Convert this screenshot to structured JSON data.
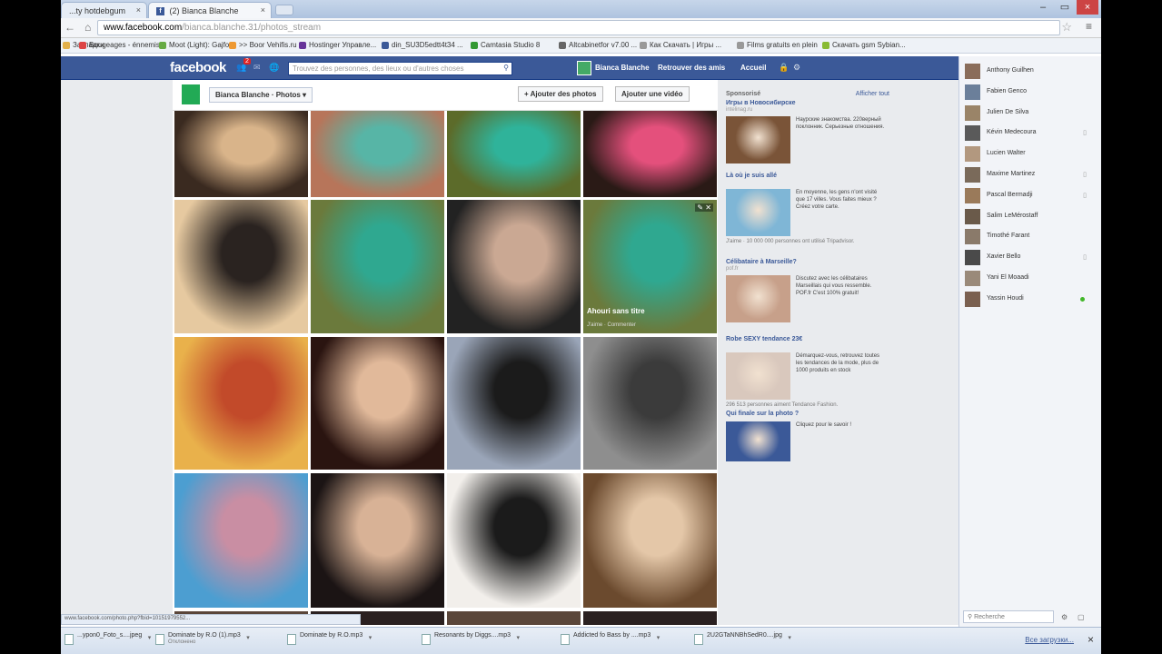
{
  "browser": {
    "tabs": [
      {
        "label": "...ty hotdebgum",
        "active": false
      },
      {
        "label": "(2) Bianca Blanche",
        "active": true
      }
    ],
    "url_domain": "www.facebook.com",
    "url_rest": "/bianca.blanche.31/photos_stream",
    "bookmarks": [
      {
        "label": "Закладки",
        "color": "#e2b04a"
      },
      {
        "label": "Bougeages - énnemis...",
        "color": "#d44"
      },
      {
        "label": "Moot (Light): Gajfor",
        "color": "#6a4"
      },
      {
        "label": ">> Boor Vehifis.ru ...",
        "color": "#e93"
      },
      {
        "label": "Hostinger Управле...",
        "color": "#639"
      },
      {
        "label": "din_SU3D5edtt4t34 ...",
        "color": "#3b5998"
      },
      {
        "label": "Camtasia Studio 8",
        "color": "#393"
      },
      {
        "label": "Altcabinetfor v7.00 ...",
        "color": "#666"
      },
      {
        "label": "Как Скачать | Игры ...",
        "color": "#999"
      },
      {
        "label": "Films gratuits en plein",
        "color": "#999"
      },
      {
        "label": "Скачать gsm Sybian...",
        "color": "#8b3"
      }
    ]
  },
  "fb": {
    "logo": "facebook",
    "notif_count": "2",
    "search_placeholder": "Trouvez des personnes, des lieux ou d'autres choses",
    "profile_name": "Bianca Blanche",
    "find_friends": "Retrouver des amis",
    "home": "Accueil"
  },
  "album": {
    "name": "Bianca Blanche",
    "section": "Photos",
    "add_photos": "+ Ajouter des photos",
    "add_video": "Ajouter une vidéo",
    "hover_caption": "Ahouri sans titre",
    "hover_actions": "J'aime · Commenter"
  },
  "photos": [
    {
      "c1": "#3a2a20",
      "c2": "#d9b48a"
    },
    {
      "c1": "#b7755a",
      "c2": "#57b5a6"
    },
    {
      "c1": "#5c6b2a",
      "c2": "#2fb39a"
    },
    {
      "c1": "#2a1a16",
      "c2": "#e4507c"
    },
    {
      "c1": "#e6c9a0",
      "c2": "#2a2320"
    },
    {
      "c1": "#6b7a3c",
      "c2": "#2fa890"
    },
    {
      "c1": "#222",
      "c2": "#caa893"
    },
    {
      "c1": "#6b7a3c",
      "c2": "#2fa890"
    },
    {
      "c1": "#e9b14b",
      "c2": "#c24a2a"
    },
    {
      "c1": "#2a1410",
      "c2": "#e1b99a"
    },
    {
      "c1": "#9aa5b8",
      "c2": "#1b1b1b"
    },
    {
      "c1": "#8e8e8e",
      "c2": "#3b3b3b"
    },
    {
      "c1": "#4c9ed1",
      "c2": "#c98ea3"
    },
    {
      "c1": "#1b1414",
      "c2": "#d8b296"
    },
    {
      "c1": "#f2efeb",
      "c2": "#1b1b1b"
    },
    {
      "c1": "#6b4a2e",
      "c2": "#e4c7a8"
    }
  ],
  "ads": {
    "heading": "Sponsorisé",
    "see_all": "Afficher tout",
    "items": [
      {
        "title": "Игры в Новосибирске",
        "sub": "intelinag.ru",
        "text": "Наурские знакомства. 220верный поклонник. Серьезные отношения.",
        "color": "#7a5438"
      },
      {
        "title": "Là où je suis allé",
        "sub": "",
        "text": "En moyenne, les gens n'ont visité que 17 villes. Vous faites mieux ? Créez votre carte.",
        "color": "#7fb6d6",
        "foot": "J'aime · 10 000 000 personnes ont utilisé Tripadvisor."
      },
      {
        "title": "Célibataire à Marseille?",
        "sub": "pof.fr",
        "text": "Discutez avec les célibataires Marseillais qui vous ressemble. POF.fr C'est 100% gratuit!",
        "color": "#c7a08a"
      },
      {
        "title": "Robe SEXY tendance 23€",
        "sub": "",
        "text": "Démarquez-vous, retrouvez toutes les tendances de la mode, plus de 1000 produits en stock",
        "color": "#d9c8bd",
        "foot": "296 513 personnes aiment Tendance Fashion."
      },
      {
        "title": "Qui finale sur la photo ?",
        "sub": "",
        "text": "Cliquez pour le savoir !",
        "color": "#3b5998"
      }
    ]
  },
  "chat": {
    "friends": [
      {
        "name": "Anthony Guilhen",
        "status": "none"
      },
      {
        "name": "Fabien Genco",
        "status": "none"
      },
      {
        "name": "Julien De Silva",
        "status": "none"
      },
      {
        "name": "Kévin Medecoura",
        "status": "mobile"
      },
      {
        "name": "Lucien Walter",
        "status": "none"
      },
      {
        "name": "Maxime Martinez",
        "status": "mobile"
      },
      {
        "name": "Pascal Bermadji",
        "status": "mobile"
      },
      {
        "name": "Salim LeMérostaff",
        "status": "none"
      },
      {
        "name": "Timothé Farant",
        "status": "none"
      },
      {
        "name": "Xavier Bello",
        "status": "mobile"
      },
      {
        "name": "Yani El Moaadi",
        "status": "none"
      },
      {
        "name": "Yassin Houdi",
        "status": "online"
      }
    ],
    "search_placeholder": "Recherche"
  },
  "status_url": "www.facebook.com/photo.php?fbid=10151979552...",
  "downloads": {
    "items": [
      {
        "name": "...ypon0_Foto_s....jpeg",
        "sub": ""
      },
      {
        "name": "Dominate by R.O (1).mp3",
        "sub": "Отклонено"
      },
      {
        "name": "Dominate by R.O.mp3",
        "sub": ""
      },
      {
        "name": "Resonants by Diggs....mp3",
        "sub": ""
      },
      {
        "name": "Addicted fo Bass by ....mp3",
        "sub": ""
      },
      {
        "name": "2U2GTaNNBhSedR0....jpg",
        "sub": ""
      }
    ],
    "all_label": "Все загрузки..."
  }
}
